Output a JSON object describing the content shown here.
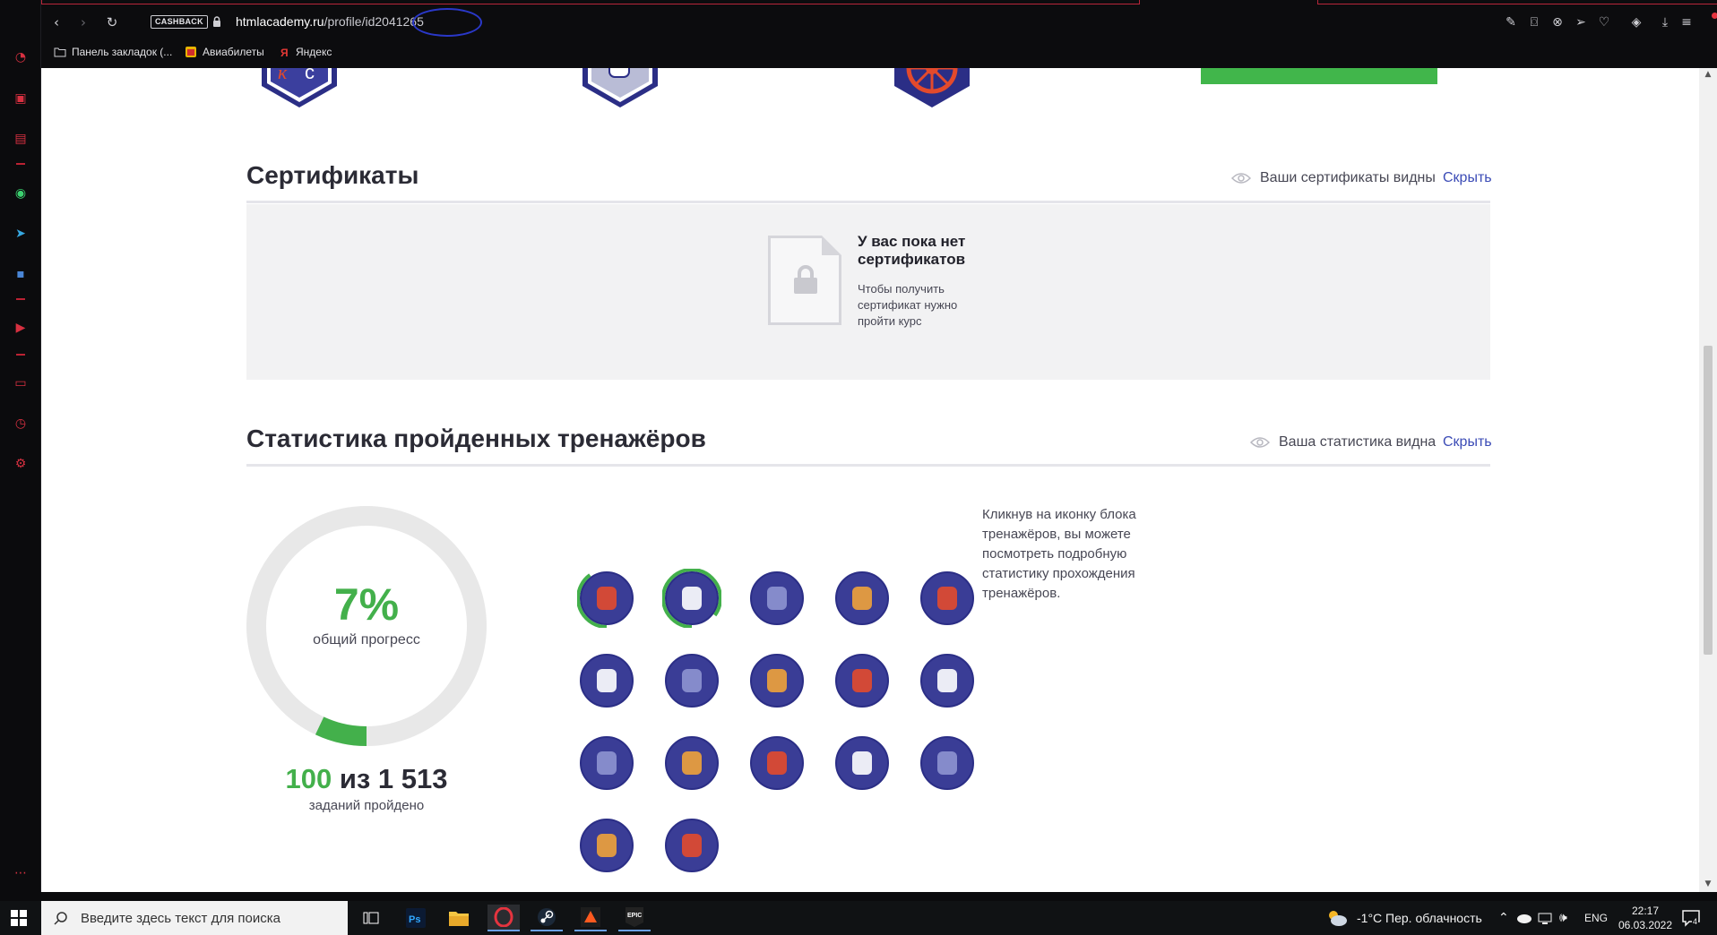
{
  "browser": {
    "url_host": "htmlacademy.ru",
    "url_path": "/profile/id2041265",
    "cashback_label": "CASHBACK",
    "bookmarks": [
      "Панель закладок (...",
      "Авиабилеты",
      "Яндекс"
    ]
  },
  "certificates": {
    "title": "Сертификаты",
    "visibility_text": "Ваши сертификаты видны",
    "hide_label": "Скрыть",
    "empty_title": "У вас пока нет сертификатов",
    "empty_sub": "Чтобы получить сертификат нужно пройти курс"
  },
  "stats": {
    "title": "Статистика пройденных тренажёров",
    "visibility_text": "Ваша статистика видна",
    "hide_label": "Скрыть",
    "progress_percent": "7%",
    "progress_fraction": 0.07,
    "progress_label": "общий прогресс",
    "tasks_done": "100",
    "tasks_sep": " из ",
    "tasks_total": "1 513",
    "tasks_label": "заданий пройдено",
    "hint": "Кликнув на иконку блока тренажёров, вы можете посмотреть подробную статистику прохождения тренажёров.",
    "trainers": [
      {
        "name": "traffic-light",
        "progress": 0.4
      },
      {
        "name": "hand",
        "progress": 0.85
      },
      {
        "name": "spinning-top",
        "progress": 0
      },
      {
        "name": "php-clapper",
        "progress": 0
      },
      {
        "name": "robot-head",
        "progress": 0
      },
      {
        "name": "braces",
        "progress": 0
      },
      {
        "name": "fox",
        "progress": 0
      },
      {
        "name": "field",
        "progress": 0
      },
      {
        "name": "paint-brush",
        "progress": 0
      },
      {
        "name": "anvil",
        "progress": 0
      },
      {
        "name": "fox-cup",
        "progress": 0
      },
      {
        "name": "clock-dots",
        "progress": 0
      },
      {
        "name": "rubik-cube",
        "progress": 0
      },
      {
        "name": "remote-control",
        "progress": 0
      },
      {
        "name": "orbit",
        "progress": 0
      },
      {
        "name": "chainsaw",
        "progress": 0
      },
      {
        "name": "letter-t",
        "progress": 0
      }
    ]
  },
  "taskbar": {
    "search_placeholder": "Введите здесь текст для поиска",
    "weather": "-1°C  Пер. облачность",
    "lang": "ENG",
    "time": "22:17",
    "date": "06.03.2022",
    "notifications": "4"
  },
  "colors": {
    "accent_green": "#43b04b",
    "link_blue": "#3c4cb6",
    "badge_navy": "#2b2e86",
    "opera_red": "#d63040"
  }
}
